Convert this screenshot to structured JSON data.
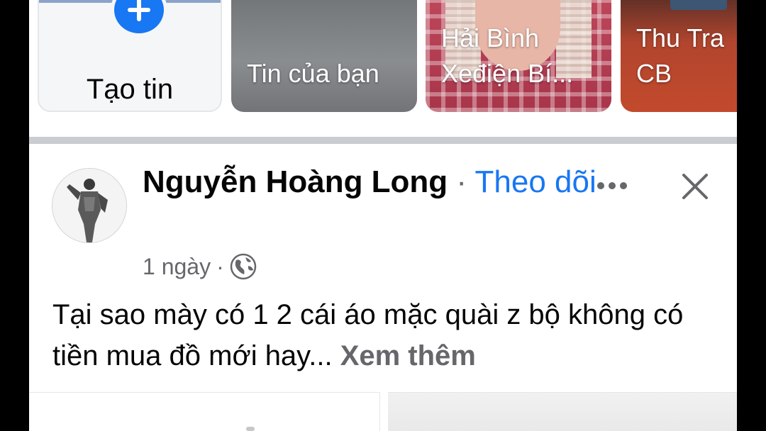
{
  "stories": {
    "create_label": "Tạo tin",
    "your_story_label": "Tin của bạn",
    "items": [
      {
        "name_line1": "Hải Bình",
        "name_line2": "Xeđiện Bí..."
      },
      {
        "name_line1": "Thu Tra",
        "name_line2": "CB"
      }
    ]
  },
  "post": {
    "author": "Nguyễn Hoàng Long",
    "separator": "·",
    "follow_label": "Theo dõi",
    "time": "1 ngày",
    "meta_separator": "·",
    "privacy_icon": "globe-icon",
    "text": "Tại sao mày có 1 2 cái áo mặc quài z bộ không có tiền mua đồ mới hay...",
    "see_more_label": "Xem thêm"
  },
  "colors": {
    "accent": "#1877f2",
    "secondary_text": "#65676b",
    "divider": "#c9ccd1"
  }
}
